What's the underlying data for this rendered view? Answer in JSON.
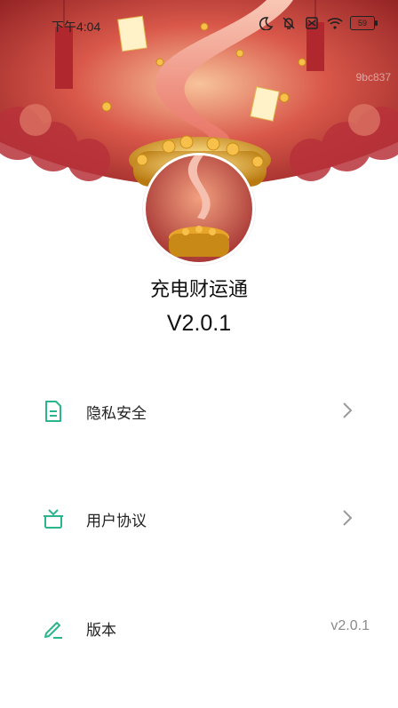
{
  "status_bar": {
    "time": "下午4:04",
    "battery": "59",
    "icons": [
      "moon-icon",
      "bell-off-icon",
      "sim-off-icon",
      "wifi-icon",
      "battery-icon"
    ]
  },
  "watermark": "9bc837",
  "app": {
    "name": "充电财运通",
    "version_label": "V2.0.1"
  },
  "menu": {
    "items": [
      {
        "label": "隐私安全",
        "icon": "document-icon",
        "trailing": "chevron-right-icon"
      },
      {
        "label": "用户协议",
        "icon": "gift-icon",
        "trailing": "chevron-right-icon"
      },
      {
        "label": "版本",
        "icon": "pencil-icon",
        "value": "v2.0.1"
      }
    ]
  },
  "colors": {
    "accent_green": "#2bb58c",
    "hero_red": "#c0392b",
    "gold": "#f2b134"
  }
}
